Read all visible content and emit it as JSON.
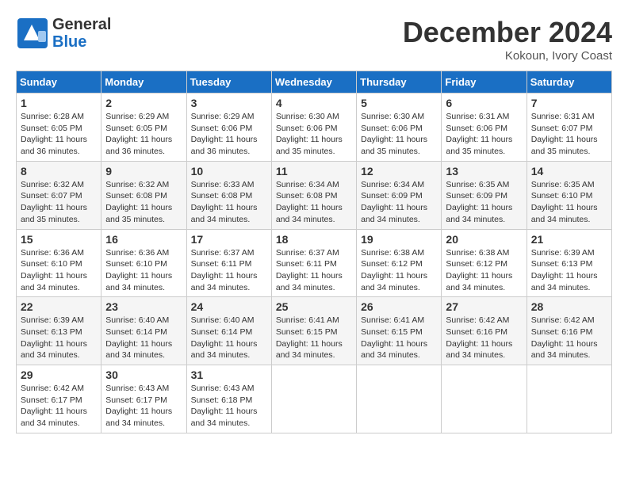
{
  "header": {
    "logo_line1": "General",
    "logo_line2": "Blue",
    "month": "December 2024",
    "location": "Kokoun, Ivory Coast"
  },
  "days_of_week": [
    "Sunday",
    "Monday",
    "Tuesday",
    "Wednesday",
    "Thursday",
    "Friday",
    "Saturday"
  ],
  "weeks": [
    [
      {
        "day": "1",
        "info": "Sunrise: 6:28 AM\nSunset: 6:05 PM\nDaylight: 11 hours\nand 36 minutes."
      },
      {
        "day": "2",
        "info": "Sunrise: 6:29 AM\nSunset: 6:05 PM\nDaylight: 11 hours\nand 36 minutes."
      },
      {
        "day": "3",
        "info": "Sunrise: 6:29 AM\nSunset: 6:06 PM\nDaylight: 11 hours\nand 36 minutes."
      },
      {
        "day": "4",
        "info": "Sunrise: 6:30 AM\nSunset: 6:06 PM\nDaylight: 11 hours\nand 35 minutes."
      },
      {
        "day": "5",
        "info": "Sunrise: 6:30 AM\nSunset: 6:06 PM\nDaylight: 11 hours\nand 35 minutes."
      },
      {
        "day": "6",
        "info": "Sunrise: 6:31 AM\nSunset: 6:06 PM\nDaylight: 11 hours\nand 35 minutes."
      },
      {
        "day": "7",
        "info": "Sunrise: 6:31 AM\nSunset: 6:07 PM\nDaylight: 11 hours\nand 35 minutes."
      }
    ],
    [
      {
        "day": "8",
        "info": "Sunrise: 6:32 AM\nSunset: 6:07 PM\nDaylight: 11 hours\nand 35 minutes."
      },
      {
        "day": "9",
        "info": "Sunrise: 6:32 AM\nSunset: 6:08 PM\nDaylight: 11 hours\nand 35 minutes."
      },
      {
        "day": "10",
        "info": "Sunrise: 6:33 AM\nSunset: 6:08 PM\nDaylight: 11 hours\nand 34 minutes."
      },
      {
        "day": "11",
        "info": "Sunrise: 6:34 AM\nSunset: 6:08 PM\nDaylight: 11 hours\nand 34 minutes."
      },
      {
        "day": "12",
        "info": "Sunrise: 6:34 AM\nSunset: 6:09 PM\nDaylight: 11 hours\nand 34 minutes."
      },
      {
        "day": "13",
        "info": "Sunrise: 6:35 AM\nSunset: 6:09 PM\nDaylight: 11 hours\nand 34 minutes."
      },
      {
        "day": "14",
        "info": "Sunrise: 6:35 AM\nSunset: 6:10 PM\nDaylight: 11 hours\nand 34 minutes."
      }
    ],
    [
      {
        "day": "15",
        "info": "Sunrise: 6:36 AM\nSunset: 6:10 PM\nDaylight: 11 hours\nand 34 minutes."
      },
      {
        "day": "16",
        "info": "Sunrise: 6:36 AM\nSunset: 6:10 PM\nDaylight: 11 hours\nand 34 minutes."
      },
      {
        "day": "17",
        "info": "Sunrise: 6:37 AM\nSunset: 6:11 PM\nDaylight: 11 hours\nand 34 minutes."
      },
      {
        "day": "18",
        "info": "Sunrise: 6:37 AM\nSunset: 6:11 PM\nDaylight: 11 hours\nand 34 minutes."
      },
      {
        "day": "19",
        "info": "Sunrise: 6:38 AM\nSunset: 6:12 PM\nDaylight: 11 hours\nand 34 minutes."
      },
      {
        "day": "20",
        "info": "Sunrise: 6:38 AM\nSunset: 6:12 PM\nDaylight: 11 hours\nand 34 minutes."
      },
      {
        "day": "21",
        "info": "Sunrise: 6:39 AM\nSunset: 6:13 PM\nDaylight: 11 hours\nand 34 minutes."
      }
    ],
    [
      {
        "day": "22",
        "info": "Sunrise: 6:39 AM\nSunset: 6:13 PM\nDaylight: 11 hours\nand 34 minutes."
      },
      {
        "day": "23",
        "info": "Sunrise: 6:40 AM\nSunset: 6:14 PM\nDaylight: 11 hours\nand 34 minutes."
      },
      {
        "day": "24",
        "info": "Sunrise: 6:40 AM\nSunset: 6:14 PM\nDaylight: 11 hours\nand 34 minutes."
      },
      {
        "day": "25",
        "info": "Sunrise: 6:41 AM\nSunset: 6:15 PM\nDaylight: 11 hours\nand 34 minutes."
      },
      {
        "day": "26",
        "info": "Sunrise: 6:41 AM\nSunset: 6:15 PM\nDaylight: 11 hours\nand 34 minutes."
      },
      {
        "day": "27",
        "info": "Sunrise: 6:42 AM\nSunset: 6:16 PM\nDaylight: 11 hours\nand 34 minutes."
      },
      {
        "day": "28",
        "info": "Sunrise: 6:42 AM\nSunset: 6:16 PM\nDaylight: 11 hours\nand 34 minutes."
      }
    ],
    [
      {
        "day": "29",
        "info": "Sunrise: 6:42 AM\nSunset: 6:17 PM\nDaylight: 11 hours\nand 34 minutes."
      },
      {
        "day": "30",
        "info": "Sunrise: 6:43 AM\nSunset: 6:17 PM\nDaylight: 11 hours\nand 34 minutes."
      },
      {
        "day": "31",
        "info": "Sunrise: 6:43 AM\nSunset: 6:18 PM\nDaylight: 11 hours\nand 34 minutes."
      },
      {
        "day": "",
        "info": ""
      },
      {
        "day": "",
        "info": ""
      },
      {
        "day": "",
        "info": ""
      },
      {
        "day": "",
        "info": ""
      }
    ]
  ]
}
